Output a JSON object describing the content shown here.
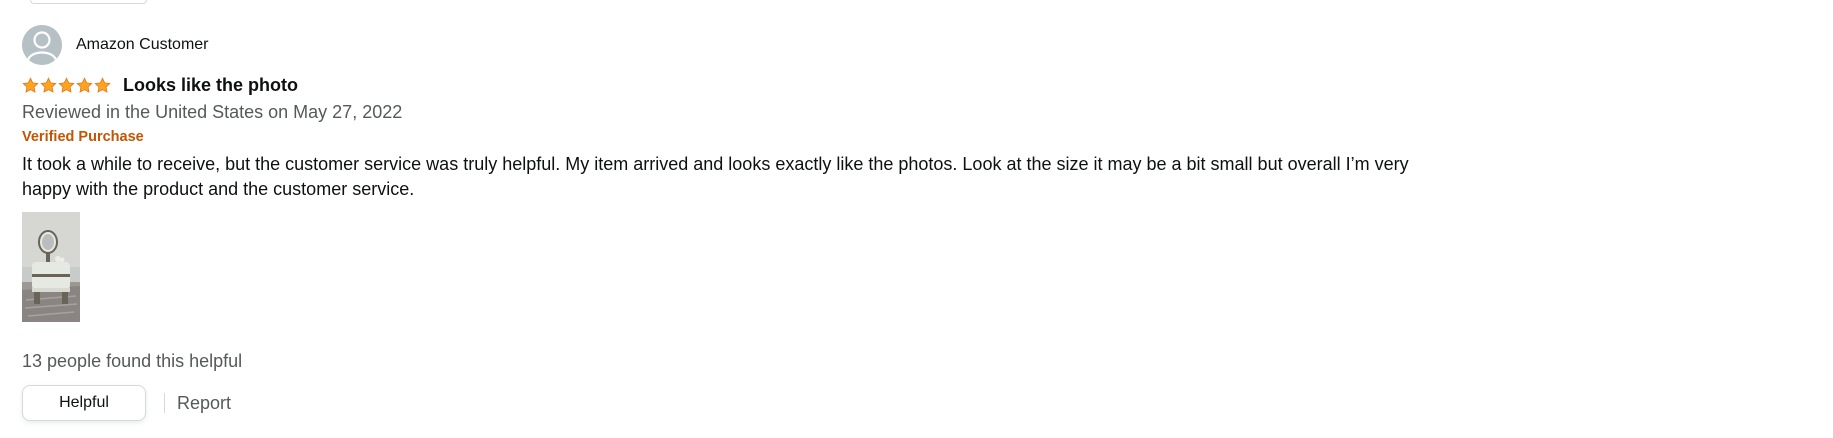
{
  "review": {
    "profile_name": "Amazon Customer",
    "rating": 5,
    "rating_max": 5,
    "title": "Looks like the photo",
    "date_line": "Reviewed in the United States on May 27, 2022",
    "badge": "Verified Purchase",
    "body": "It took a while to receive, but the customer service was truly helpful. My item arrived and looks exactly like the photos. Look at the size it may be a bit small but overall I’m very happy with the product and the customer service.",
    "helpful_count": "13 people found this helpful",
    "helpful_button_label": "Helpful",
    "report_label": "Report"
  },
  "colors": {
    "star": "#FFA41C",
    "badge": "#C45500",
    "secondary_text": "#565959",
    "primary_text": "#0F1111"
  },
  "icons": {
    "avatar": "default-user-avatar",
    "star": "filled-star-icon",
    "thumbnail": "review-photo-thumbnail"
  }
}
